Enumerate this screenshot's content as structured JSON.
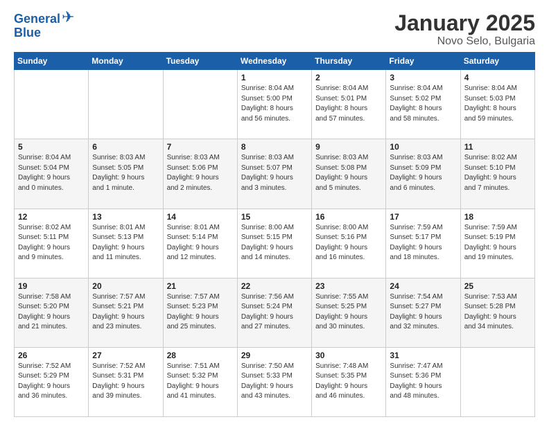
{
  "header": {
    "logo_general": "General",
    "logo_blue": "Blue",
    "month": "January 2025",
    "location": "Novo Selo, Bulgaria"
  },
  "days_of_week": [
    "Sunday",
    "Monday",
    "Tuesday",
    "Wednesday",
    "Thursday",
    "Friday",
    "Saturday"
  ],
  "weeks": [
    [
      {
        "day": "",
        "info": ""
      },
      {
        "day": "",
        "info": ""
      },
      {
        "day": "",
        "info": ""
      },
      {
        "day": "1",
        "info": "Sunrise: 8:04 AM\nSunset: 5:00 PM\nDaylight: 8 hours\nand 56 minutes."
      },
      {
        "day": "2",
        "info": "Sunrise: 8:04 AM\nSunset: 5:01 PM\nDaylight: 8 hours\nand 57 minutes."
      },
      {
        "day": "3",
        "info": "Sunrise: 8:04 AM\nSunset: 5:02 PM\nDaylight: 8 hours\nand 58 minutes."
      },
      {
        "day": "4",
        "info": "Sunrise: 8:04 AM\nSunset: 5:03 PM\nDaylight: 8 hours\nand 59 minutes."
      }
    ],
    [
      {
        "day": "5",
        "info": "Sunrise: 8:04 AM\nSunset: 5:04 PM\nDaylight: 9 hours\nand 0 minutes."
      },
      {
        "day": "6",
        "info": "Sunrise: 8:03 AM\nSunset: 5:05 PM\nDaylight: 9 hours\nand 1 minute."
      },
      {
        "day": "7",
        "info": "Sunrise: 8:03 AM\nSunset: 5:06 PM\nDaylight: 9 hours\nand 2 minutes."
      },
      {
        "day": "8",
        "info": "Sunrise: 8:03 AM\nSunset: 5:07 PM\nDaylight: 9 hours\nand 3 minutes."
      },
      {
        "day": "9",
        "info": "Sunrise: 8:03 AM\nSunset: 5:08 PM\nDaylight: 9 hours\nand 5 minutes."
      },
      {
        "day": "10",
        "info": "Sunrise: 8:03 AM\nSunset: 5:09 PM\nDaylight: 9 hours\nand 6 minutes."
      },
      {
        "day": "11",
        "info": "Sunrise: 8:02 AM\nSunset: 5:10 PM\nDaylight: 9 hours\nand 7 minutes."
      }
    ],
    [
      {
        "day": "12",
        "info": "Sunrise: 8:02 AM\nSunset: 5:11 PM\nDaylight: 9 hours\nand 9 minutes."
      },
      {
        "day": "13",
        "info": "Sunrise: 8:01 AM\nSunset: 5:13 PM\nDaylight: 9 hours\nand 11 minutes."
      },
      {
        "day": "14",
        "info": "Sunrise: 8:01 AM\nSunset: 5:14 PM\nDaylight: 9 hours\nand 12 minutes."
      },
      {
        "day": "15",
        "info": "Sunrise: 8:00 AM\nSunset: 5:15 PM\nDaylight: 9 hours\nand 14 minutes."
      },
      {
        "day": "16",
        "info": "Sunrise: 8:00 AM\nSunset: 5:16 PM\nDaylight: 9 hours\nand 16 minutes."
      },
      {
        "day": "17",
        "info": "Sunrise: 7:59 AM\nSunset: 5:17 PM\nDaylight: 9 hours\nand 18 minutes."
      },
      {
        "day": "18",
        "info": "Sunrise: 7:59 AM\nSunset: 5:19 PM\nDaylight: 9 hours\nand 19 minutes."
      }
    ],
    [
      {
        "day": "19",
        "info": "Sunrise: 7:58 AM\nSunset: 5:20 PM\nDaylight: 9 hours\nand 21 minutes."
      },
      {
        "day": "20",
        "info": "Sunrise: 7:57 AM\nSunset: 5:21 PM\nDaylight: 9 hours\nand 23 minutes."
      },
      {
        "day": "21",
        "info": "Sunrise: 7:57 AM\nSunset: 5:23 PM\nDaylight: 9 hours\nand 25 minutes."
      },
      {
        "day": "22",
        "info": "Sunrise: 7:56 AM\nSunset: 5:24 PM\nDaylight: 9 hours\nand 27 minutes."
      },
      {
        "day": "23",
        "info": "Sunrise: 7:55 AM\nSunset: 5:25 PM\nDaylight: 9 hours\nand 30 minutes."
      },
      {
        "day": "24",
        "info": "Sunrise: 7:54 AM\nSunset: 5:27 PM\nDaylight: 9 hours\nand 32 minutes."
      },
      {
        "day": "25",
        "info": "Sunrise: 7:53 AM\nSunset: 5:28 PM\nDaylight: 9 hours\nand 34 minutes."
      }
    ],
    [
      {
        "day": "26",
        "info": "Sunrise: 7:52 AM\nSunset: 5:29 PM\nDaylight: 9 hours\nand 36 minutes."
      },
      {
        "day": "27",
        "info": "Sunrise: 7:52 AM\nSunset: 5:31 PM\nDaylight: 9 hours\nand 39 minutes."
      },
      {
        "day": "28",
        "info": "Sunrise: 7:51 AM\nSunset: 5:32 PM\nDaylight: 9 hours\nand 41 minutes."
      },
      {
        "day": "29",
        "info": "Sunrise: 7:50 AM\nSunset: 5:33 PM\nDaylight: 9 hours\nand 43 minutes."
      },
      {
        "day": "30",
        "info": "Sunrise: 7:48 AM\nSunset: 5:35 PM\nDaylight: 9 hours\nand 46 minutes."
      },
      {
        "day": "31",
        "info": "Sunrise: 7:47 AM\nSunset: 5:36 PM\nDaylight: 9 hours\nand 48 minutes."
      },
      {
        "day": "",
        "info": ""
      }
    ]
  ]
}
